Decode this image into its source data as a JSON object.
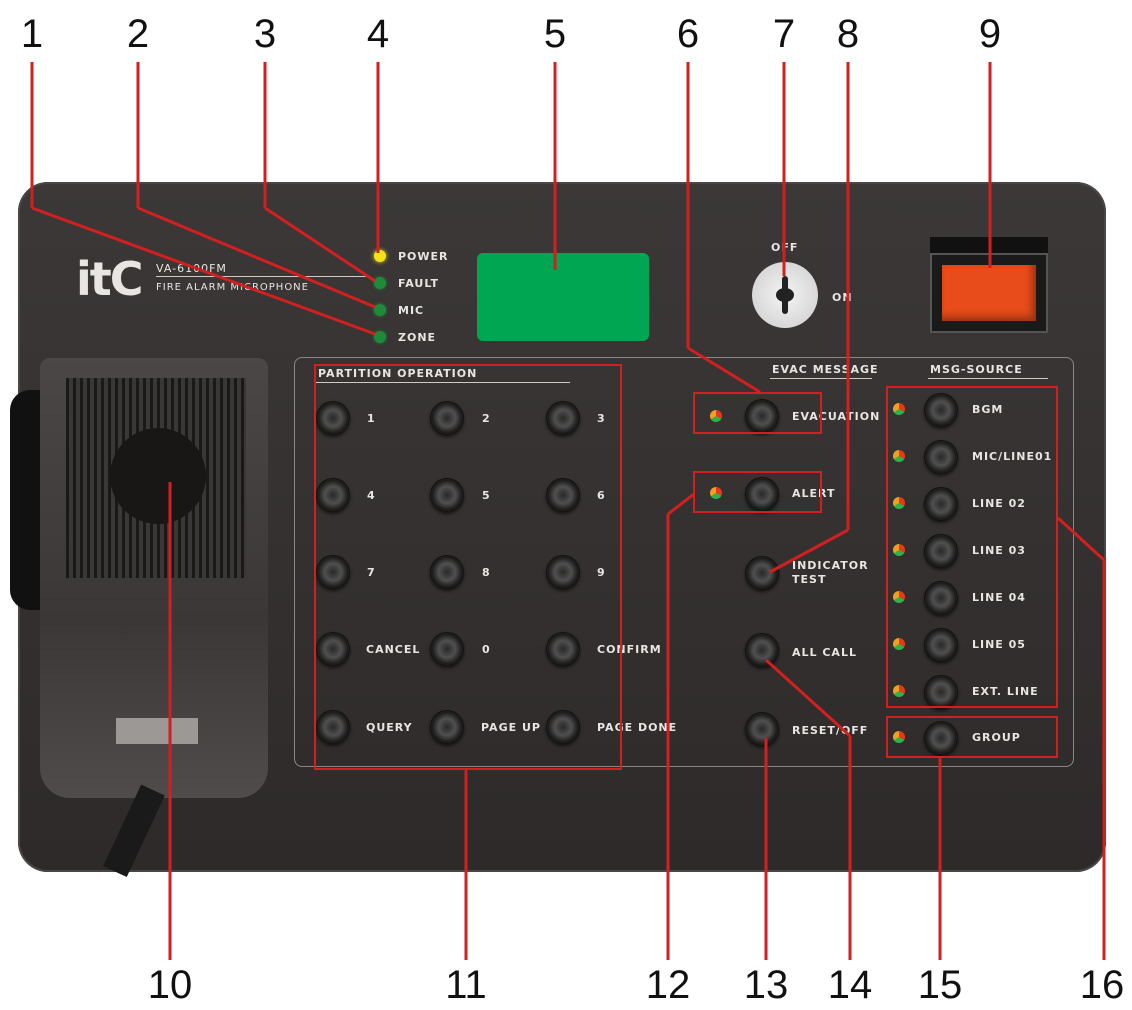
{
  "callouts": [
    "1",
    "2",
    "3",
    "4",
    "5",
    "6",
    "7",
    "8",
    "9",
    "10",
    "11",
    "12",
    "13",
    "14",
    "15",
    "16"
  ],
  "brand": {
    "logo": "itC",
    "model": "VA-6100FM",
    "product": "FIRE ALARM MICROPHONE"
  },
  "indicators": [
    "POWER",
    "FAULT",
    "MIC",
    "ZONE"
  ],
  "key_switch": {
    "off": "OFF",
    "on": "ON"
  },
  "partition": {
    "title": "PARTITION OPERATION",
    "keys": [
      "1",
      "2",
      "3",
      "4",
      "5",
      "6",
      "7",
      "8",
      "9",
      "CANCEL",
      "0",
      "CONFIRM",
      "QUERY",
      "PAGE UP",
      "PAGE DONE"
    ]
  },
  "evac": {
    "title": "EVAC MESSAGE",
    "buttons": [
      "EVACUATION",
      "ALERT",
      "INDICATOR TEST",
      "ALL CALL",
      "RESET/OFF"
    ]
  },
  "msg_source": {
    "title": "MSG-SOURCE",
    "buttons": [
      "BGM",
      "MIC/LINE01",
      "LINE 02",
      "LINE 03",
      "LINE 04",
      "LINE 05",
      "EXT. LINE",
      "GROUP"
    ]
  },
  "colors": {
    "annotation": "#d21f1f",
    "display": "#00a651",
    "power_switch": "#e84c1a"
  }
}
